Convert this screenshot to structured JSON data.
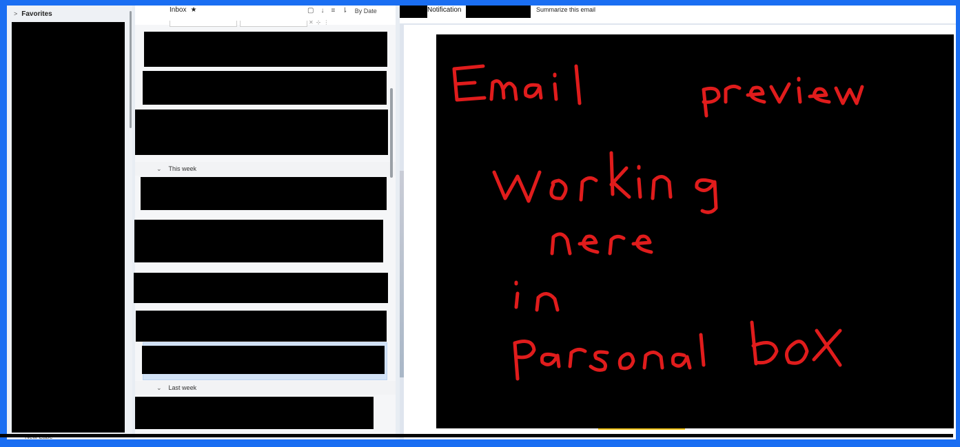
{
  "folder_pane": {
    "favorites_label": "Favorites",
    "new_label_text": "New Labe"
  },
  "message_list": {
    "title": "Inbox",
    "sort_label": "By Date",
    "groups": [
      {
        "label": "This week"
      },
      {
        "label": "Last week"
      }
    ]
  },
  "reading_pane": {
    "notification_label": "Notification",
    "summarize_label": "Summarize this email",
    "annotation": [
      "Email",
      "preview",
      "working",
      "nere",
      "in",
      "personal",
      "box"
    ]
  },
  "colors": {
    "border": "#1a6ef2",
    "annotation_ink": "#e01c1c",
    "selection": "#d3e3f7",
    "accent": "#f5c518"
  }
}
